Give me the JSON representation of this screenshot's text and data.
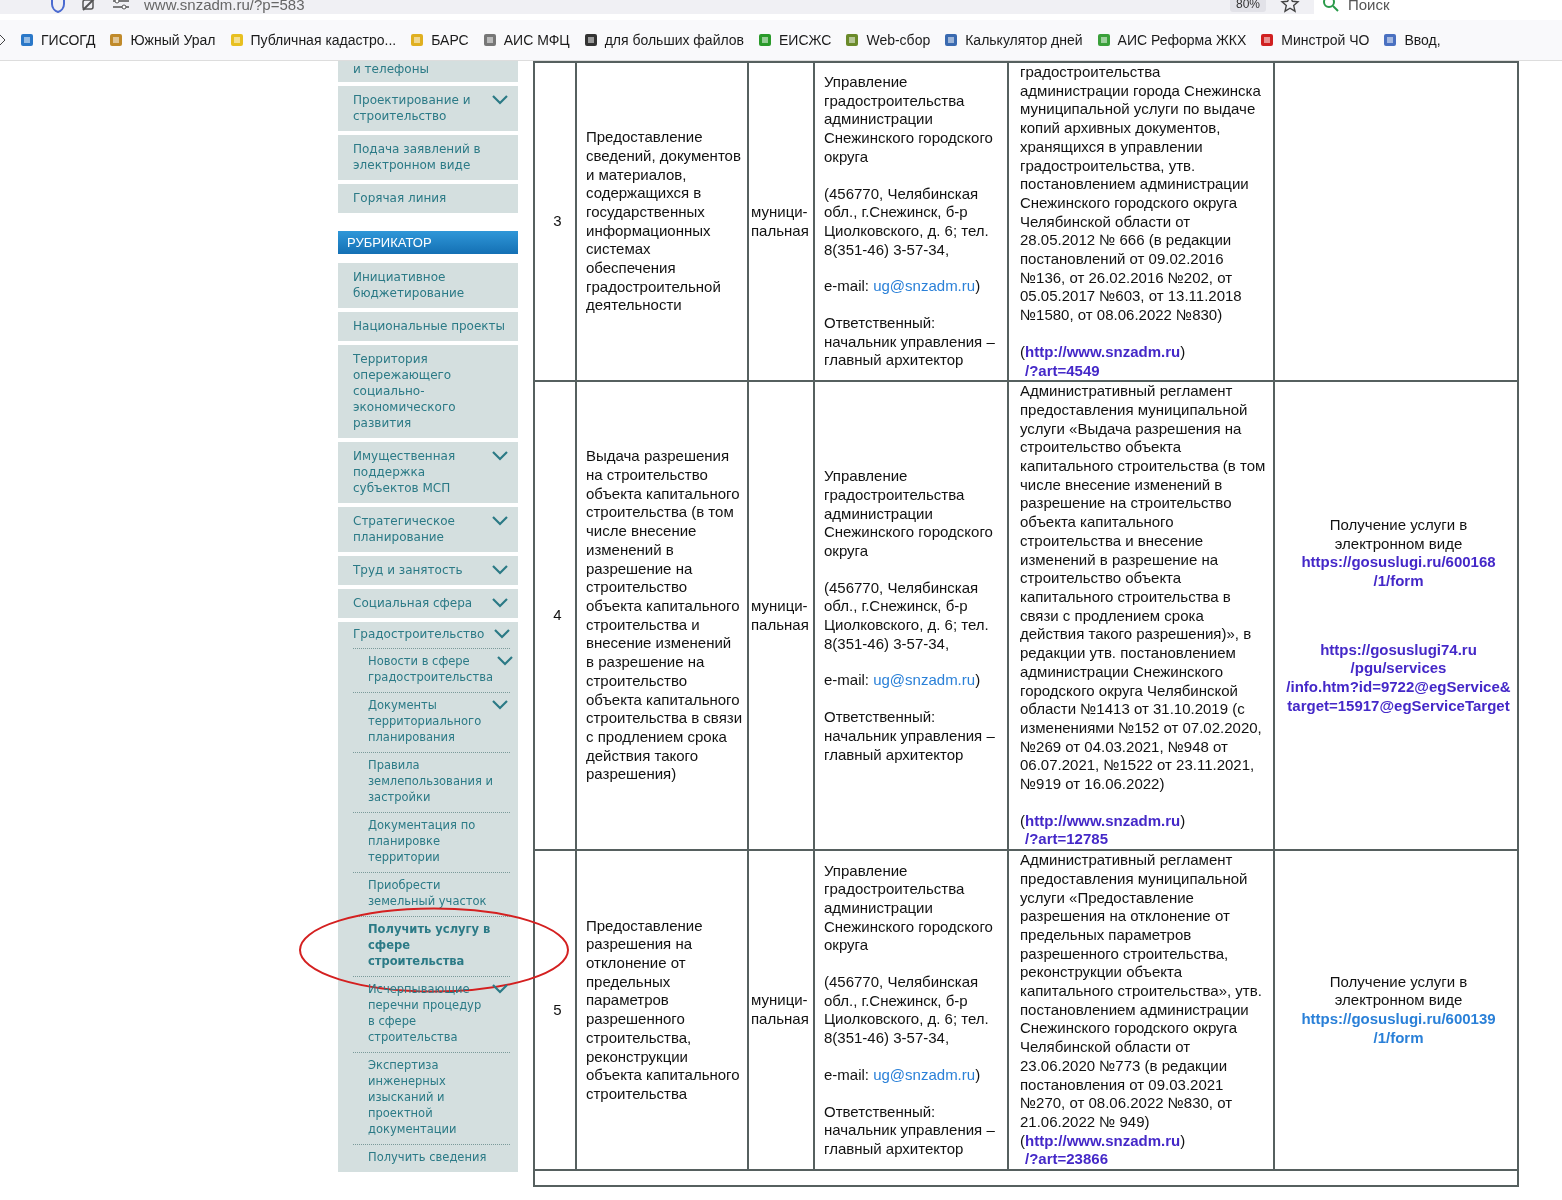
{
  "browser": {
    "url": "www.snzadm.ru/?p=583",
    "zoom": "80%",
    "search_placeholder": "Поиск",
    "bookmarks": [
      "ГИСОГД",
      "Южный Урал",
      "Публичная кадастро...",
      "БАРС",
      "АИС МФЦ",
      "для больших файлов",
      "ЕИСЖС",
      "Web-сбор",
      "Калькулятор дней",
      "АИС Реформа ЖКХ",
      "Минстрой ЧО",
      "Ввод,"
    ]
  },
  "sidebar": {
    "top_items": [
      {
        "label": "и телефоны",
        "has_submenu": false
      },
      {
        "label": "Проектирование и строительство",
        "has_submenu": true
      },
      {
        "label": "Подача заявлений в электронном виде",
        "has_submenu": false
      },
      {
        "label": "Горячая линия",
        "has_submenu": false
      }
    ],
    "section_title": "РУБРИКАТОР",
    "items": [
      {
        "label": "Инициативное бюджетирование",
        "has_submenu": false
      },
      {
        "label": "Национальные проекты",
        "has_submenu": false
      },
      {
        "label": "Территория опережающего социально-экономического развития",
        "has_submenu": false
      },
      {
        "label": "Имущественная поддержка субъектов МСП",
        "has_submenu": true
      },
      {
        "label": "Стратегическое планирование",
        "has_submenu": true
      },
      {
        "label": "Труд и занятость",
        "has_submenu": true
      },
      {
        "label": "Социальная сфера",
        "has_submenu": true
      },
      {
        "label": "Градостроительство",
        "has_submenu": true,
        "children": [
          {
            "label": "Новости в сфере градостроительства",
            "has_submenu": true,
            "selected": false
          },
          {
            "label": "Документы территориального планирования",
            "has_submenu": true,
            "selected": false
          },
          {
            "label": "Правила землепользования и застройки",
            "has_submenu": false,
            "selected": false
          },
          {
            "label": "Документация по планировке территории",
            "has_submenu": false,
            "selected": false
          },
          {
            "label": "Приобрести земельный участок",
            "has_submenu": false,
            "selected": false
          },
          {
            "label": "Получить услугу в сфере строительства",
            "has_submenu": false,
            "selected": true
          },
          {
            "label": "Исчерпывающие перечни процедур в сфере строительства",
            "has_submenu": true,
            "selected": false
          },
          {
            "label": "Экспертиза инженерных изысканий и проектной документации",
            "has_submenu": false,
            "selected": false
          },
          {
            "label": "Получить сведения",
            "has_submenu": false,
            "selected": false
          }
        ]
      }
    ]
  },
  "table": {
    "rows": [
      {
        "number": "3",
        "service": "Предоставление сведений, документов и материалов, содержащихся в государственных информационных системах обеспечения градостроительной деятельности",
        "type": "муници-пальная",
        "org": {
          "name": "Управление градостроительства администрации Снежинского городского округа",
          "address": "(456770, Челябинская обл., г.Снежинск, б-р Циолковского, д. 6; тел. 8(351-46) 3-57-34,",
          "email_prefix": "e-mail:",
          "email": "ug@snzadm.ru",
          "email_suffix": ")",
          "responsible": "Ответственный: начальник управления – главный архитектор"
        },
        "regulation": {
          "text": "градостроительства администрации города Снежинска муниципальной услуги по выдаче копий архивных документов, хранящихся в управлении градостроительства, утв. постановлением администрации Снежинского городского округа Челябинской области от 28.05.2012 № 666 (в редакции постановлений от 09.02.2016 №136, от 26.02.2016 №202, от 05.05.2017 №603, от 13.11.2018 №1580, от 08.06.2022 №830)",
          "link_separate": true,
          "link_before": "(",
          "link": [
            "http://www.snzadm.ru",
            "/?art=4549"
          ],
          "link_after": ")"
        },
        "online": null
      },
      {
        "number": "4",
        "service": "Выдача разрешения на строительство объекта капитального строительства (в том числе внесение изменений в разрешение на строительство объекта капитального строительства и внесение изменений в разрешение на строительство объекта капитального строительства в связи с продлением срока действия такого разрешения)",
        "type": "муници-пальная",
        "org": {
          "name": "Управление градостроительства администрации Снежинского городского округа",
          "address": "(456770, Челябинская обл., г.Снежинск, б-р Циолковского, д. 6; тел. 8(351-46) 3-57-34,",
          "email_prefix": "e-mail:",
          "email": "ug@snzadm.ru",
          "email_suffix": ")",
          "responsible": "Ответственный: начальник управления – главный архитектор"
        },
        "regulation": {
          "text": "Административный регламент предоставления муниципальной услуги «Выдача разрешения на строительство объекта капитального строительства (в том числе внесение изменений в разрешение на строительство объекта капитального строительства и внесение изменений в разрешение на строительство объекта капитального строительства в связи с продлением срока действия такого разрешения)», в редакции утв. постановлением администрации Снежинского городского округа Челябинской области №1413 от 31.10.2019 (с изменениями №152 от 07.02.2020,  №269 от 04.03.2021, №948 от 06.07.2021, №1522 от 23.11.2021, №919 от 16.06.2022)",
          "link_separate": true,
          "link_before": "(",
          "link": [
            "http://www.snzadm.ru",
            "/?art=12785"
          ],
          "link_after": ")"
        },
        "online": {
          "text": "Получение услуги в электронном виде",
          "links": [
            {
              "lines": [
                "https://gosuslugi.ru/600168",
                "/1/form"
              ],
              "visited": true
            },
            {
              "lines": [
                "https://gosuslugi74.ru",
                "/pgu/services",
                "/info.htm?id=9722@egService&",
                "target=15917@egServiceTarget"
              ],
              "visited": true
            }
          ]
        }
      },
      {
        "number": "5",
        "service": "Предоставление разрешения на отклонение от предельных параметров разрешенного строительства, реконструкции объекта капитального строительства",
        "type": "муници-пальная",
        "org": {
          "name": "Управление градостроительства администрации Снежинского городского округа",
          "address": "(456770, Челябинская обл., г.Снежинск, б-р Циолковского, д. 6; тел. 8(351-46) 3-57-34,",
          "email_prefix": "e-mail:",
          "email": "ug@snzadm.ru",
          "email_suffix": ")",
          "responsible": "Ответственный: начальник управления – главный архитектор"
        },
        "regulation": {
          "text": "Административный регламент предоставления муниципальной услуги «Предоставление разрешения на отклонение от предельных параметров разрешенного строительства, реконструкции объекта капитального строительства», утв. постановлением администрации Снежинского городского округа Челябинской области от 23.06.2020 №773 (в редакции постановления от 09.03.2021 №270, от 08.06.2022 №830, от 21.06.2022 № 949)",
          "link_separate": false,
          "link_before": "(",
          "link": [
            "http://www.snzadm.ru",
            "/?art=23866"
          ],
          "link_after": ")"
        },
        "online": {
          "text": "Получение услуги в электронном виде",
          "links": [
            {
              "lines": [
                "https://gosuslugi.ru/600139",
                "/1/form"
              ],
              "visited": false
            }
          ]
        }
      }
    ]
  }
}
